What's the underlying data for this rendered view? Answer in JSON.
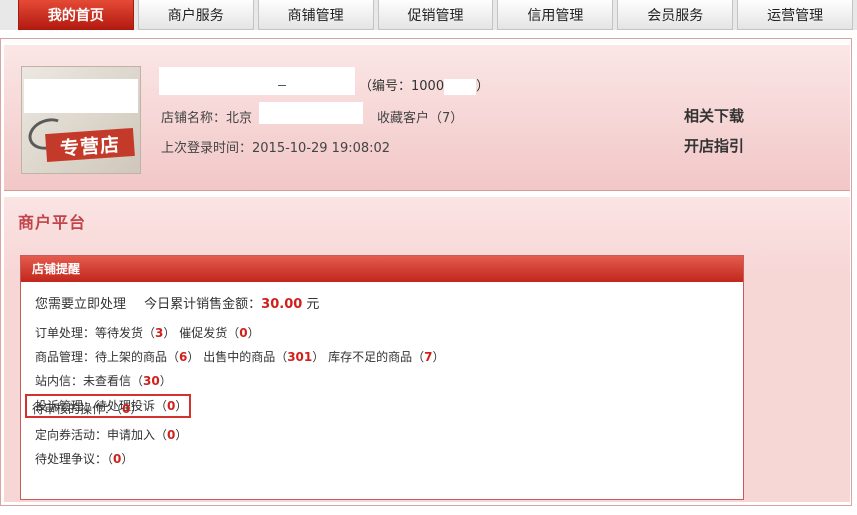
{
  "nav": {
    "items": [
      "我的首页",
      "商户服务",
      "商铺管理",
      "促销管理",
      "信用管理",
      "会员服务",
      "运营管理"
    ]
  },
  "profile": {
    "avatar_text": "专营店",
    "store_number_prefix": "（编号：1000",
    "store_number_suffix": "）",
    "store_name_label": "店铺名称：北京",
    "favorite": "收藏客户（7）",
    "last_login": "上次登录时间：2015-10-29 19:08:02",
    "links": [
      "相关下载",
      "开店指引"
    ]
  },
  "platform": {
    "title": "商户平台",
    "panel_title": "店铺提醒",
    "need_process": "您需要立即处理",
    "sales_label": "今日累计销售金额：",
    "sales_value": "30.00",
    "sales_unit": " 元",
    "rows": {
      "orders": {
        "label": "订单处理：等待发货（",
        "v1": "3",
        "mid": "）  催促发货（",
        "v2": "0",
        "end": "）"
      },
      "goods": {
        "label": "商品管理：待上架的商品（",
        "v1": "6",
        "mid1": "）  出售中的商品（",
        "v2": "301",
        "mid2": "）  库存不足的商品（",
        "v3": "7",
        "end": "）"
      },
      "messages": {
        "label": "站内信：未查看信（",
        "v1": "30",
        "end": "）"
      },
      "complaints": {
        "label": "投诉管理：待处理投诉（",
        "v1": "0",
        "end": "）"
      },
      "review": {
        "label": "待审核的操作：（",
        "v1": "0",
        "end": "）"
      },
      "coupons": {
        "label": "定向券活动：申请加入（",
        "v1": "0",
        "end": "）"
      },
      "disputes": {
        "label": "待处理争议：（",
        "v1": "0",
        "end": "）"
      }
    }
  }
}
